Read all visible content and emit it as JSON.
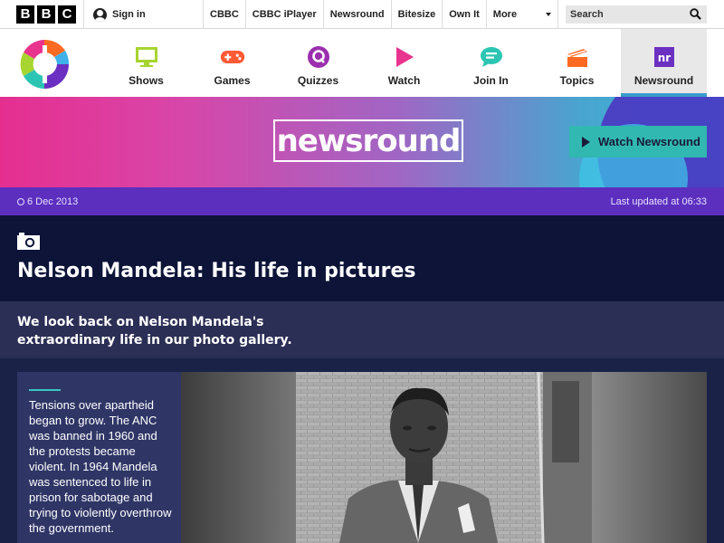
{
  "bbc_bar": {
    "logo_letters": [
      "B",
      "B",
      "C"
    ],
    "signin_label": "Sign in",
    "nav": [
      "CBBC",
      "CBBC iPlayer",
      "Newsround",
      "Bitesize",
      "Own It",
      "More"
    ],
    "search_placeholder": "Search"
  },
  "cbbc_nav": {
    "items": [
      {
        "label": "Shows",
        "icon": "tv-icon",
        "color": "#a7d42f"
      },
      {
        "label": "Games",
        "icon": "gamepad-icon",
        "color": "#ff5a36"
      },
      {
        "label": "Quizzes",
        "icon": "quiz-icon",
        "color": "#9b2fae"
      },
      {
        "label": "Watch",
        "icon": "play-icon",
        "color": "#e8338f"
      },
      {
        "label": "Join In",
        "icon": "chat-icon",
        "color": "#2cc5b3"
      },
      {
        "label": "Topics",
        "icon": "stack-icon",
        "color": "#ff6a22"
      },
      {
        "label": "Newsround",
        "icon": "newsround-icon",
        "color": "#6b2fc1"
      }
    ],
    "active": "Newsround"
  },
  "banner": {
    "logo_text": "newsround",
    "watch_label": "Watch Newsround"
  },
  "article": {
    "date": "6 Dec 2013",
    "updated": "Last updated at 06:33",
    "title": "Nelson Mandela: His life in pictures",
    "summary": "We look back on Nelson Mandela's extraordinary life in our photo gallery.",
    "caption": "Tensions over apartheid began to grow. The ANC was banned in 1960 and the protests became violent. In 1964 Mandela was sentenced to life in prison for sabotage and trying to violently overthrow the government."
  },
  "colors": {
    "accent_teal": "#31b8b0",
    "date_strip": "#5c2fbf",
    "headline_bg": "#0d1438"
  }
}
